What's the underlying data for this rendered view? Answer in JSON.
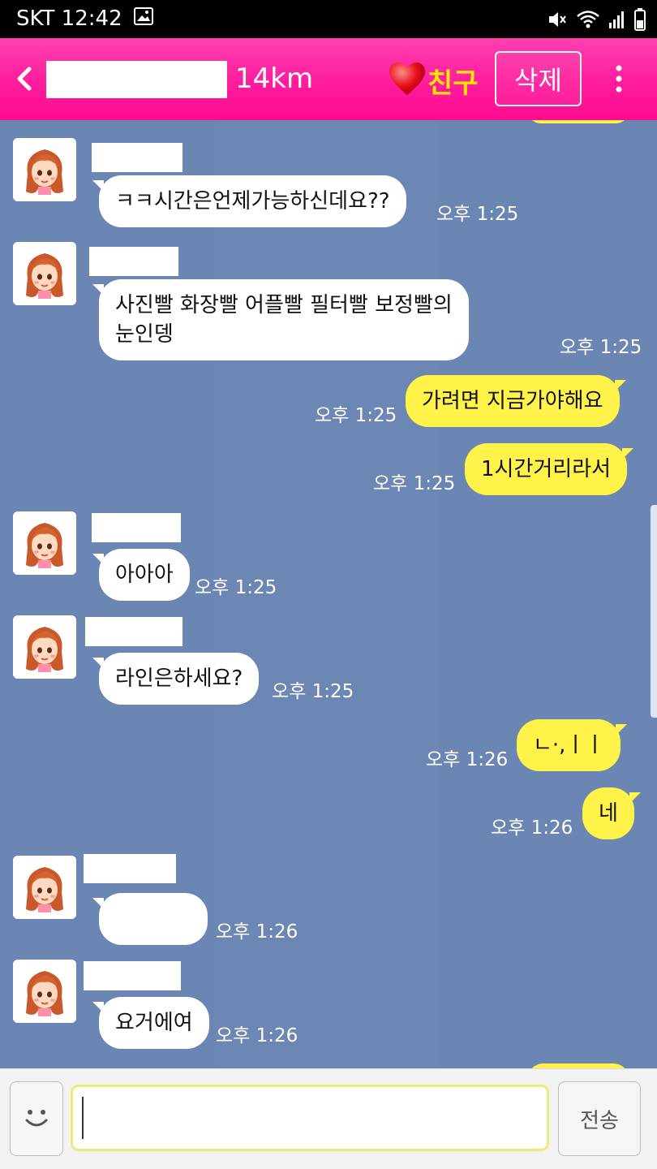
{
  "status_bar": {
    "carrier_time": "SKT 12:42",
    "icons": [
      "image-icon",
      "mute-icon",
      "wifi-icon",
      "signal-icon",
      "battery-icon"
    ]
  },
  "header": {
    "distance": "14km",
    "friend_label": "친구",
    "delete_label": "삭제",
    "colors": {
      "background": "#ff1a9c",
      "friend_text": "#ffe600"
    }
  },
  "messages": [
    {
      "side": "in",
      "text": "ㅋㅋ시간은언제가능하신데요??",
      "time": "오후 1:25"
    },
    {
      "side": "in",
      "text": "사진빨 화장빨 어플빨 필터빨 보정빨의\n눈인뎅",
      "time": "오후 1:25"
    },
    {
      "side": "out",
      "text": "가려면 지금가야해요",
      "time": "오후 1:25"
    },
    {
      "side": "out",
      "text": "1시간거리라서",
      "time": "오후 1:25"
    },
    {
      "side": "in",
      "text": "아아아",
      "time": "오후 1:25"
    },
    {
      "side": "in",
      "text": "라인은하세요?",
      "time": "오후 1:25"
    },
    {
      "side": "out",
      "text": "ㄴ·,ㅣㅣ",
      "time": "오후 1:26"
    },
    {
      "side": "out",
      "text": "네",
      "time": "오후 1:26"
    },
    {
      "side": "in",
      "text": "",
      "time": "오후 1:26"
    },
    {
      "side": "in",
      "text": "요거에여",
      "time": "오후 1:26"
    }
  ],
  "input": {
    "value": "",
    "send_label": "전송"
  },
  "colors": {
    "chat_background": "#6b86b2",
    "outgoing_bubble": "#fff248",
    "incoming_bubble": "#ffffff"
  }
}
